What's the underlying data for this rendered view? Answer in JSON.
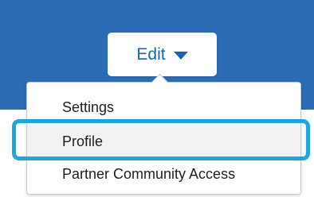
{
  "edit_button": {
    "label": "Edit",
    "icon": "chevron-down-icon"
  },
  "menu": {
    "items": [
      {
        "label": "Settings"
      },
      {
        "label": "Profile",
        "selected": true
      },
      {
        "label": "Partner Community Access"
      }
    ]
  },
  "colors": {
    "banner": "#2b6cb5",
    "accent": "#1565c0",
    "highlight": "#1aa8e0"
  }
}
